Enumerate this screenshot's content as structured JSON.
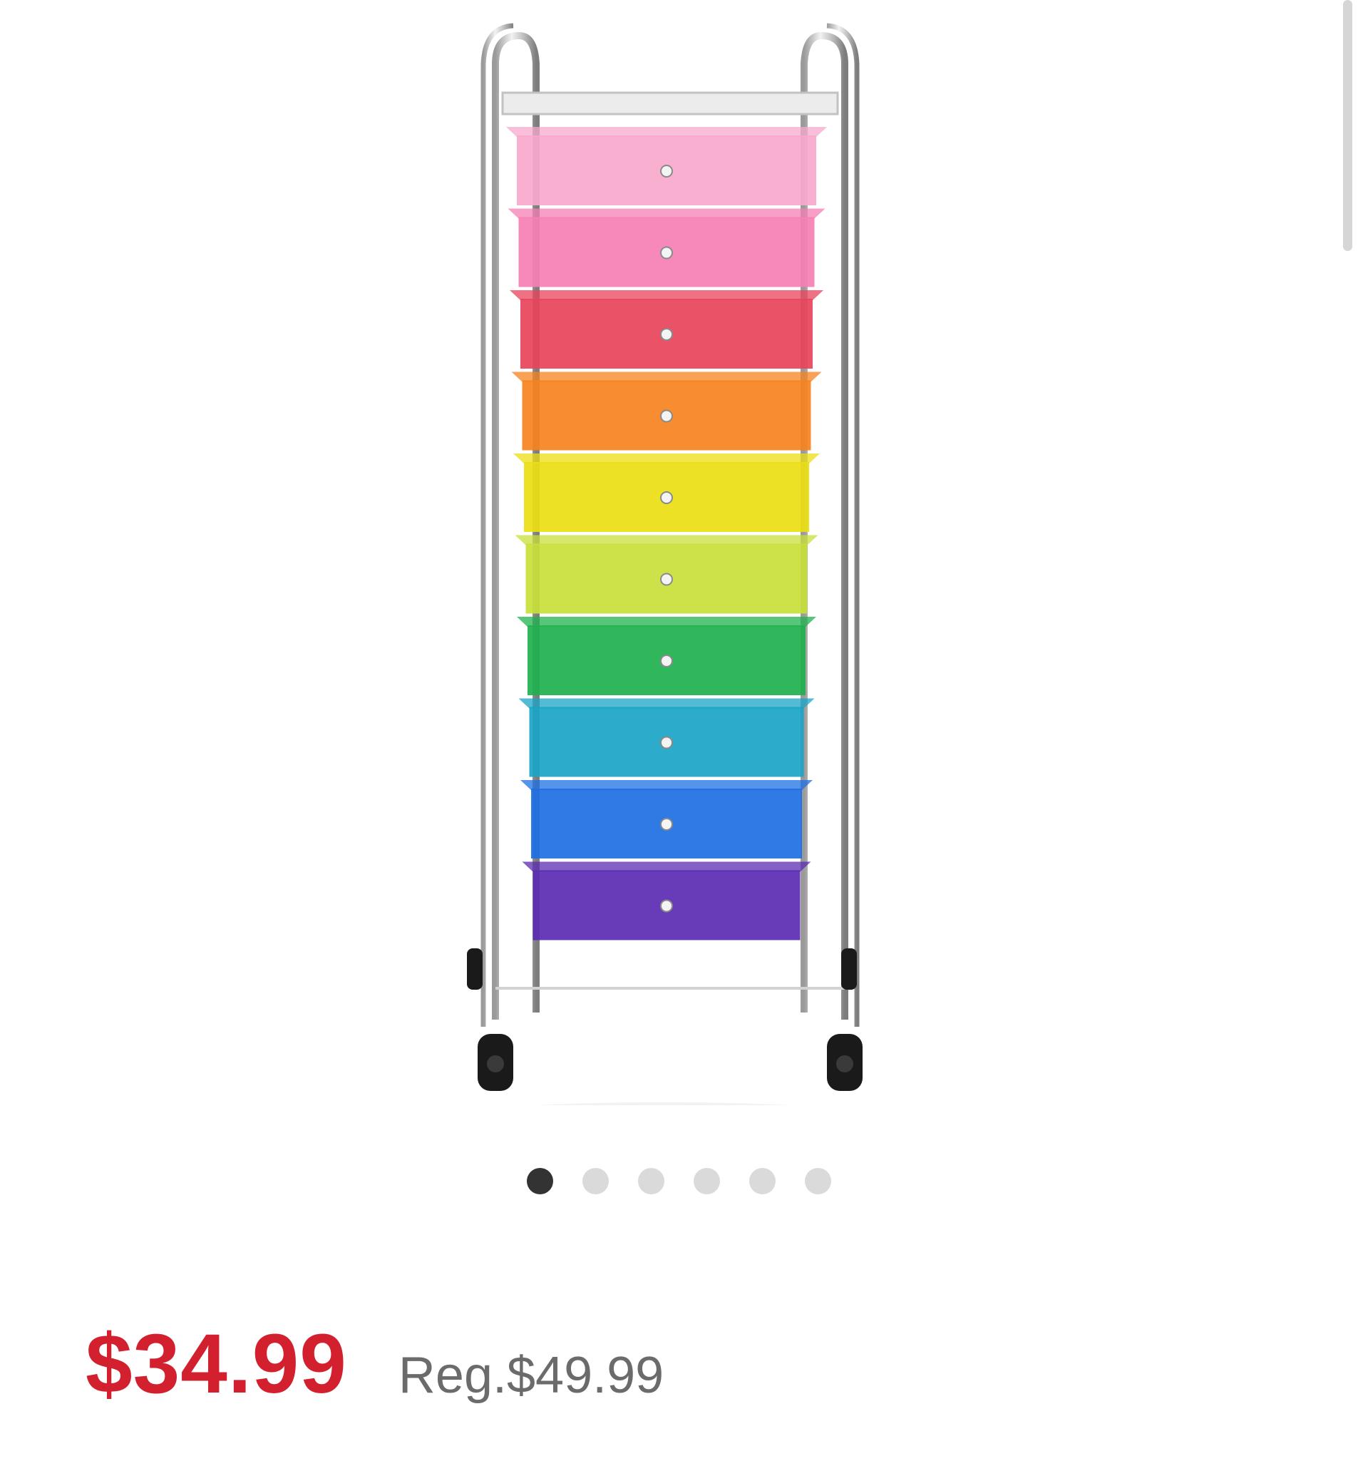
{
  "product": {
    "image_alt": "product-image",
    "drawer_colors": [
      "#f7a8cc",
      "#f57fb4",
      "#e8435a",
      "#f7821e",
      "#ecde12",
      "#c9df3a",
      "#1fb14d",
      "#1aa4c6",
      "#1d6fe3",
      "#5b2bb2"
    ],
    "frame_color": "#c8c8c8",
    "caster_color": "#1a1a1a"
  },
  "carousel": {
    "total": 6,
    "active_index": 0,
    "active_color": "#333333",
    "inactive_color": "#dadada"
  },
  "pricing": {
    "sale_price": "$34.99",
    "regular_price": "Reg.$49.99",
    "sale_color": "#d3202f",
    "regular_color": "#6b6b6b"
  }
}
